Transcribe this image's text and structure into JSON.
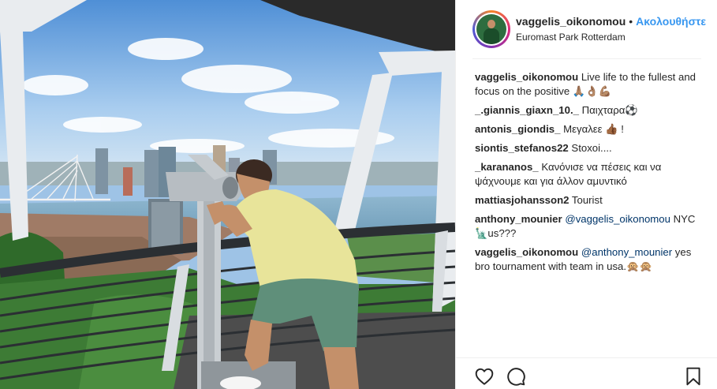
{
  "post": {
    "username": "vaggelis_oikonomou",
    "separator": "•",
    "follow_label": "Ακολουθήστε",
    "location": "Euromast Park Rotterdam"
  },
  "comments": [
    {
      "author": "vaggelis_oikonomou",
      "pre": "Live life to the fullest and focus on the positive 🙏🏽👌🏽💪🏽",
      "mention": "",
      "post": ""
    },
    {
      "author": "_.giannis_giaxn_10._",
      "pre": "Παιχταρα⚽",
      "mention": "",
      "post": ""
    },
    {
      "author": "antonis_giondis_",
      "pre": "Μεγαλεε 👍🏾 !",
      "mention": "",
      "post": ""
    },
    {
      "author": "siontis_stefanos22",
      "pre": "Stoxoi....",
      "mention": "",
      "post": ""
    },
    {
      "author": "_karananos_",
      "pre": "Κανόνισε να πέσεις και να ψάχνουμε και για άλλον αμυντικό",
      "mention": "",
      "post": ""
    },
    {
      "author": "mattiasjohansson2",
      "pre": "Tourist",
      "mention": "",
      "post": ""
    },
    {
      "author": "anthony_mounier",
      "pre": "",
      "mention": "@vaggelis_oikonomou",
      "post": " NYC 🗽us???"
    },
    {
      "author": "vaggelis_oikonomou",
      "pre": "",
      "mention": "@anthony_mounier",
      "post": " yes bro tournament with team in usa.🙊🙊"
    }
  ],
  "actions": {
    "like_icon": "heart-icon",
    "comment_icon": "speech-bubble-icon",
    "save_icon": "bookmark-icon"
  },
  "colors": {
    "link_blue": "#3897f0",
    "mention_blue": "#003569",
    "text": "#262626",
    "divider": "#efefef"
  }
}
